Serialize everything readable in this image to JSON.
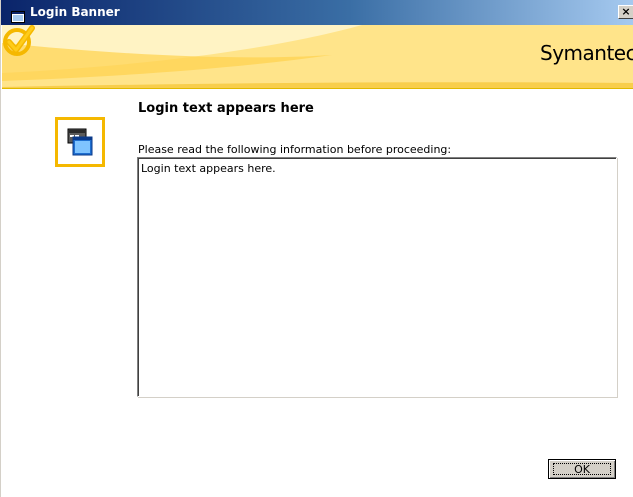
{
  "window": {
    "title": "Login Banner",
    "close_label": "×"
  },
  "banner": {
    "brand": "Symantec.",
    "accent_color": "#f5b800",
    "check_color": "#f5b800"
  },
  "content": {
    "heading": "Login text appears here",
    "instructions": "Please read the following information before proceeding:",
    "message": "Login text appears here."
  },
  "buttons": {
    "ok_label": "OK"
  },
  "icons": {
    "title_icon": "window-app-icon",
    "app_icon": "terminal-window-icon",
    "brand_icon": "checkmark-icon"
  }
}
